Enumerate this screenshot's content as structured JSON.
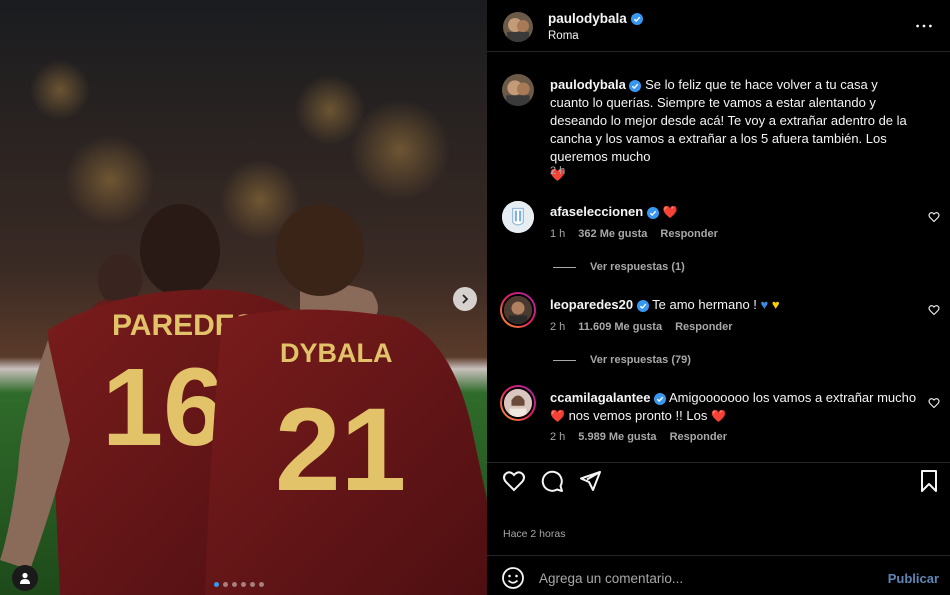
{
  "post": {
    "author": "paulodybala",
    "location": "Roma",
    "photo_alt_jerseys": [
      {
        "name": "PAREDES",
        "number": "16"
      },
      {
        "name": "DYBALA",
        "number": "21"
      }
    ],
    "carousel": {
      "count": 6,
      "active_index": 0
    },
    "colors": {
      "verified": "#3897f0",
      "heart": "#ed4956",
      "publish": "#5f86b3",
      "background": "#000000"
    }
  },
  "caption": {
    "user": "paulodybala",
    "text": "Se lo feliz que te hace volver a tu casa y cuanto lo querías. Siempre te vamos a estar alentando y deseando lo mejor desde acá! Te voy a extrañar adentro de la cancha y los vamos a extrañar a los 5 afuera también. Los queremos mucho",
    "time": "2 h"
  },
  "comments": [
    {
      "user": "afaseleccionen",
      "text": "",
      "time": "1 h",
      "likes": "362 Me gusta",
      "reply_label": "Responder",
      "view_replies": "Ver respuestas (1)"
    },
    {
      "user": "leoparedes20",
      "text": "Te amo hermano !",
      "time": "2 h",
      "likes": "11.609 Me gusta",
      "reply_label": "Responder",
      "view_replies": "Ver respuestas (79)"
    },
    {
      "user": "ccamilagalantee",
      "text": "Amigooooooo los vamos a extrañar mucho",
      "text2": "nos vemos pronto !! Los",
      "time": "2 h",
      "likes": "5.989 Me gusta",
      "reply_label": "Responder"
    }
  ],
  "footer": {
    "time_ago": "Hace 2 horas",
    "comment_placeholder": "Agrega un comentario...",
    "publish_label": "Publicar"
  },
  "icons": [
    "verified-icon",
    "more-options-icon",
    "heart-icon",
    "comment-icon",
    "share-icon",
    "bookmark-icon",
    "emoji-icon",
    "chevron-right-icon",
    "user-tag-icon"
  ]
}
